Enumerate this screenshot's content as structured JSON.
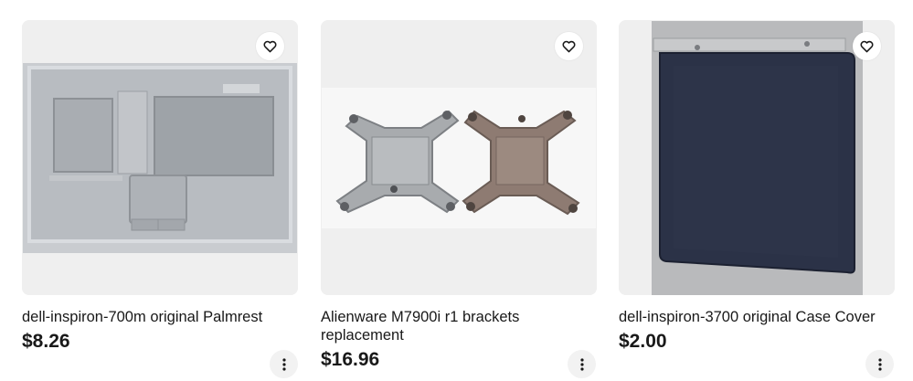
{
  "listings": [
    {
      "title": "dell-inspiron-700m original Palmrest",
      "price": "$8.26",
      "image_icon": "laptop-palmrest-photo",
      "favorite_icon": "heart-icon",
      "more_icon": "more-vertical-icon"
    },
    {
      "title": "Alienware M7900i r1 brackets replacement",
      "price": "$16.96",
      "image_icon": "heatsink-brackets-photo",
      "favorite_icon": "heart-icon",
      "more_icon": "more-vertical-icon"
    },
    {
      "title": "dell-inspiron-3700 original Case Cover",
      "price": "$2.00",
      "image_icon": "case-cover-photo",
      "favorite_icon": "heart-icon",
      "more_icon": "more-vertical-icon"
    }
  ]
}
